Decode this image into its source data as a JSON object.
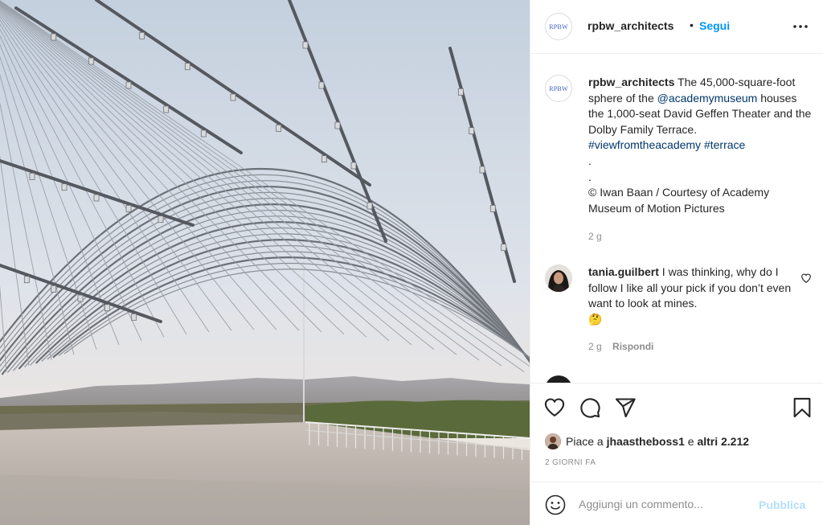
{
  "photo": {
    "alt": "",
    "sky_top": "#c9d4e0",
    "sky_bottom": "#f2e9df",
    "floor": "#b9b2ab"
  },
  "header": {
    "logo_text": "RPBW",
    "username": "rpbw_architects",
    "separator": "•",
    "follow_label": "Segui",
    "more_icon": "more-horizontal-icon"
  },
  "caption": {
    "username": "rpbw_architects",
    "text_1": "The 45,000-square-foot sphere of the",
    "mention": "@academymuseum",
    "text_2": "houses the 1,000-seat David Geffen Theater and the Dolby Family Terrace.",
    "hashtag_1": "#viewfromtheacademy",
    "hashtag_2": "#terrace",
    "dot_1": ".",
    "dot_2": ".",
    "credit": "© Iwan Baan / Courtesy of Academy Museum of Motion Pictures",
    "time": "2 g"
  },
  "comment": {
    "username": "tania.guilbert",
    "text": "I was thinking, why do I follow I like all your pick if you don’t even want to look at mines.",
    "emoji": "🤔",
    "time": "2 g",
    "reply_label": "Rispondi"
  },
  "actions": {
    "like_icon": "heart-icon",
    "comment_icon": "comment-icon",
    "share_icon": "paper-plane-icon",
    "save_icon": "bookmark-icon"
  },
  "likes": {
    "prefix": "Piace a",
    "user": "jhaastheboss1",
    "conj": "e",
    "others": "altri 2.212"
  },
  "date": "2 GIORNI FA",
  "add_comment": {
    "placeholder": "Aggiungi un commento...",
    "publish_label": "Pubblica",
    "emoji_icon": "smiley-icon"
  }
}
